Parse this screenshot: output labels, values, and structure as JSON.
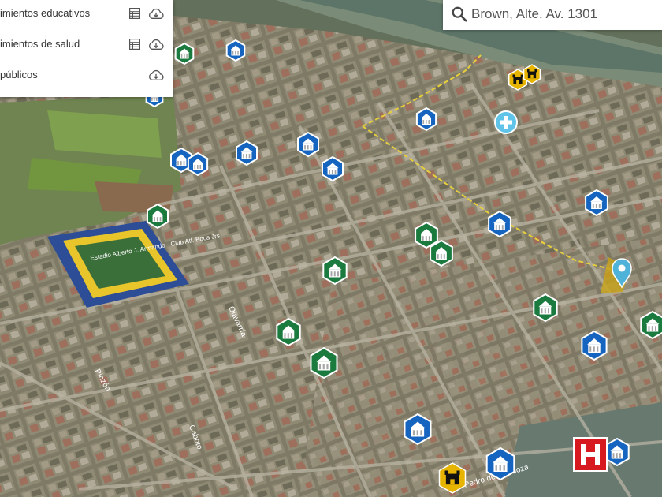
{
  "layers": [
    {
      "label": "imientos educativos",
      "has_table": true,
      "has_download": true
    },
    {
      "label": "imientos de salud",
      "has_table": true,
      "has_download": true
    },
    {
      "label": "públicos",
      "has_table": false,
      "has_download": true
    }
  ],
  "search": {
    "value": "Brown, Alte. Av. 1301"
  },
  "map": {
    "stadium_text": "Estadio Alberto J. Armando - Club Atl. Boca Jrs.",
    "street_labels": [
      "Pedro de Mendoza",
      "Caboto",
      "Olavarría",
      "Pinzón",
      "Pedro de Mendoza"
    ],
    "colors": {
      "education": "#1565c0",
      "health": "#1b7a3e",
      "public": "#e7b400",
      "hospital": "#d71920",
      "location": "#4fb3d9",
      "aid": "#5fc4e8"
    }
  }
}
